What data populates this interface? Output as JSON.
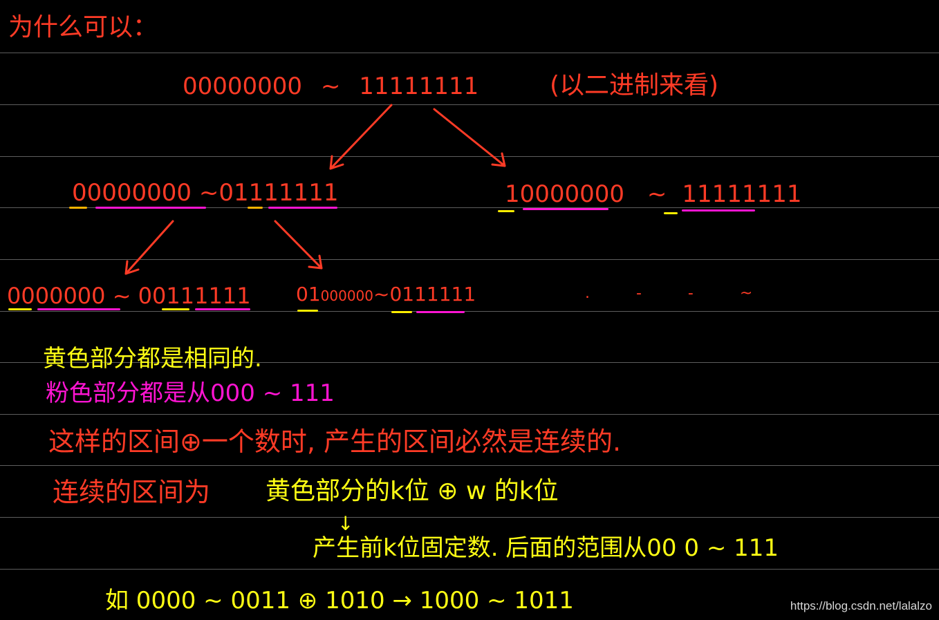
{
  "heading": "为什么可以：",
  "top_range": {
    "from": "00000000",
    "sep": "~",
    "to": "11111111",
    "note": "(以二进制来看)"
  },
  "level2": {
    "left": {
      "prefix_a": "0",
      "rest_a": "0000000",
      "sep": "~",
      "prefix_b": "0",
      "rest_b": "1111111"
    },
    "right": {
      "prefix_a": "1",
      "rest_a": "0000000",
      "sep": "~",
      "prefix_b": "1",
      "rest_b": "1111111"
    }
  },
  "level3": {
    "a": {
      "prefix_a": "0",
      "rest_a": "000000",
      "sep": "~",
      "prefix_b": "00",
      "rest_b": "111111"
    },
    "b": {
      "prefix_a": "01",
      "rest_a": "000000",
      "sep": "~",
      "prefix_b": "01",
      "rest_b": "11111"
    },
    "more": ". - - ~"
  },
  "notes": {
    "yellow_line": "黄色部分都是相同的.",
    "pink_line": "粉色部分都是从000 ~ 111",
    "line3": "这样的区间⊕一个数时, 产生的区间必然是连续的.",
    "line4_red": "连续的区间为",
    "line4_yellow": "黄色部分的k位 ⊕ w 的k位",
    "arrow_glyph": "↓",
    "line5": "产生前k位固定数. 后面的范围从00 0 ~ 111",
    "example": "如 0000 ~ 0011 ⊕ 1010 → 1000 ~ 1011"
  },
  "watermark": "https://blog.csdn.net/lalalzo",
  "colors": {
    "red": "#ff3b26",
    "yellow": "#ffff14",
    "pink": "#ff14d2",
    "background": "#000000"
  }
}
